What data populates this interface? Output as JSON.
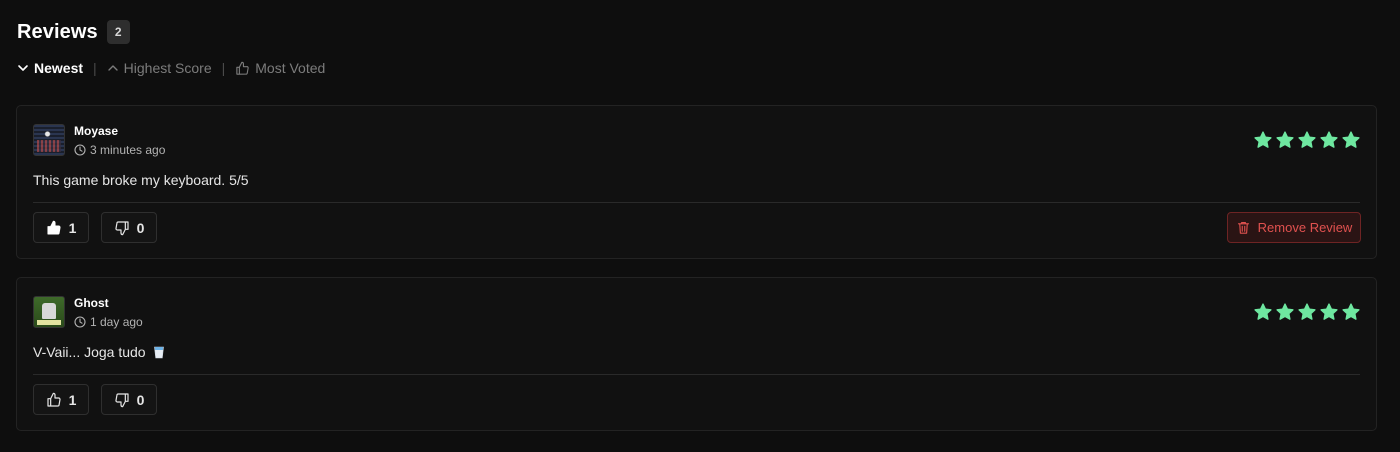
{
  "header": {
    "title": "Reviews",
    "count": "2"
  },
  "sort": {
    "options": [
      {
        "label": "Newest",
        "icon": "chevron-down-icon",
        "active": true
      },
      {
        "label": "Highest Score",
        "icon": "chevron-up-icon",
        "active": false
      },
      {
        "label": "Most Voted",
        "icon": "thumbs-up-icon",
        "active": false
      }
    ],
    "separator": "|"
  },
  "reviews": [
    {
      "username": "Moyase",
      "time": "3 minutes ago",
      "rating": 5,
      "max_rating": 5,
      "text": "This game broke my keyboard. 5/5",
      "upvotes": "1",
      "downvotes": "0",
      "upvoted": true,
      "remove_label": "Remove Review"
    },
    {
      "username": "Ghost",
      "time": "1 day ago",
      "rating": 5,
      "max_rating": 5,
      "text": "V-Vaii... Joga tudo",
      "text_emoji": "cup-with-straw-icon",
      "upvotes": "1",
      "downvotes": "0",
      "upvoted": false
    }
  ],
  "colors": {
    "background": "#0e0e0e",
    "card": "#111111",
    "star": "#6ee7a0",
    "danger": "#e0514f",
    "muted": "#7c7c7c"
  }
}
